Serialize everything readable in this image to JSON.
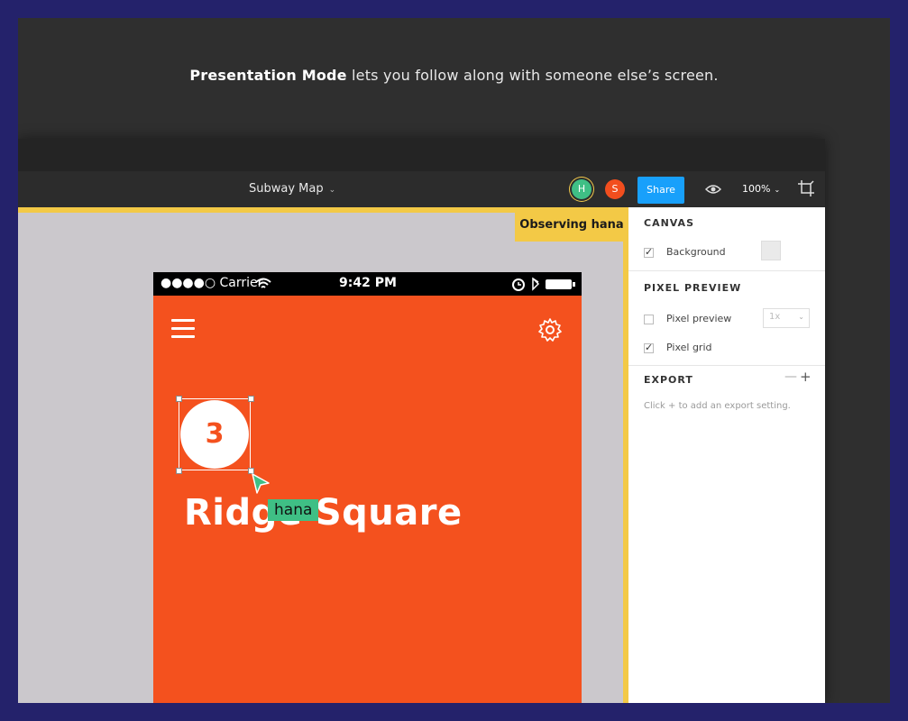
{
  "caption": {
    "bold": "Presentation Mode",
    "rest": " lets you follow along with someone else’s screen."
  },
  "toolbar": {
    "doc_title": "Subway Map",
    "avatar_h": "H",
    "avatar_s": "S",
    "share_label": "Share",
    "zoom": "100%"
  },
  "canvas": {
    "observing_label": "Observing hana"
  },
  "phone": {
    "carrier": "●●●●○ Carrier",
    "time": "9:42 PM",
    "badge": "3",
    "station": "Ridge Square",
    "cursor_user": "hana"
  },
  "panel": {
    "canvas_title": "CANVAS",
    "background_label": "Background",
    "pixel_preview_title": "PIXEL PREVIEW",
    "pixel_preview_label": "Pixel preview",
    "pixel_preview_scale": "1x",
    "pixel_grid_label": "Pixel grid",
    "export_title": "EXPORT",
    "export_hint": "Click + to add an export setting."
  },
  "colors": {
    "accent": "#18a0fb",
    "observe": "#f3c946",
    "phone_bg": "#f4511e",
    "cursor": "#3fbf85"
  }
}
